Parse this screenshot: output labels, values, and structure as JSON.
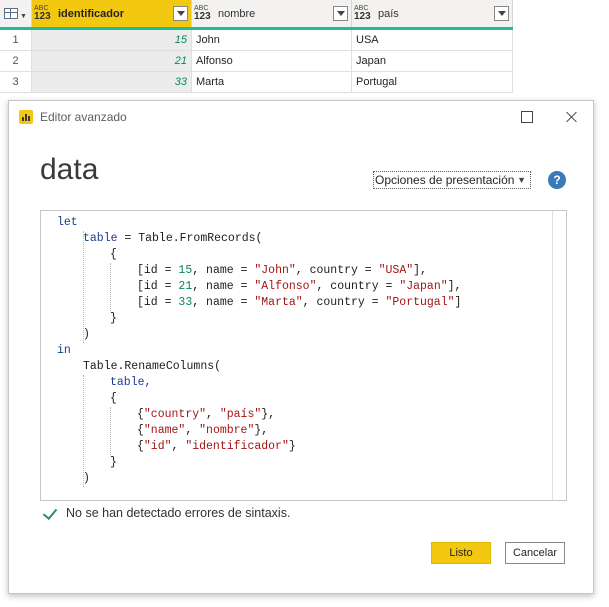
{
  "grid": {
    "columns": [
      {
        "type_top": "ABC",
        "type_bottom": "123",
        "name": "identificador"
      },
      {
        "type_top": "ABC",
        "type_bottom": "123",
        "name": "nombre"
      },
      {
        "type_top": "ABC",
        "type_bottom": "123",
        "name": "país"
      }
    ],
    "rows": [
      {
        "n": "1",
        "id": "15",
        "nombre": "John",
        "pais": "USA"
      },
      {
        "n": "2",
        "id": "21",
        "nombre": "Alfonso",
        "pais": "Japan"
      },
      {
        "n": "3",
        "id": "33",
        "nombre": "Marta",
        "pais": "Portugal"
      }
    ]
  },
  "dialog": {
    "title": "Editor avanzado",
    "query_name": "data",
    "display_options_label": "Opciones de presentación",
    "help": "?",
    "status": "No se han detectado errores de sintaxis.",
    "ok_label": "Listo",
    "cancel_label": "Cancelar"
  },
  "code": {
    "l1": "let",
    "l2a": "table",
    "l2b": " = Table.FromRecords(",
    "l3": "{",
    "row1": {
      "a": "[id = ",
      "id": "15",
      "b": ", name = ",
      "name": "\"John\"",
      "c": ", country = ",
      "country": "\"USA\"",
      "d": "],"
    },
    "row2": {
      "a": "[id = ",
      "id": "21",
      "b": ", name = ",
      "name": "\"Alfonso\"",
      "c": ", country = ",
      "country": "\"Japan\"",
      "d": "],"
    },
    "row3": {
      "a": "[id = ",
      "id": "33",
      "b": ", name = ",
      "name": "\"Marta\"",
      "c": ", country = ",
      "country": "\"Portugal\"",
      "d": "]"
    },
    "l7": "}",
    "l8": ")",
    "l9": "in",
    "l10": "Table.RenameColumns(",
    "l11": "table,",
    "l12": "{",
    "p1": {
      "a": "{",
      "x": "\"country\"",
      "b": ", ",
      "y": "\"país\"",
      "c": "},"
    },
    "p2": {
      "a": "{",
      "x": "\"name\"",
      "b": ", ",
      "y": "\"nombre\"",
      "c": "},"
    },
    "p3": {
      "a": "{",
      "x": "\"id\"",
      "b": ", ",
      "y": "\"identificador\"",
      "c": "}"
    },
    "l16": "}",
    "l17": ")"
  },
  "colors": {
    "accent_yellow": "#f2c811",
    "header_underline": "#1fbc9c",
    "check_green": "#2a8f6e",
    "help_blue": "#3a7ab8"
  }
}
